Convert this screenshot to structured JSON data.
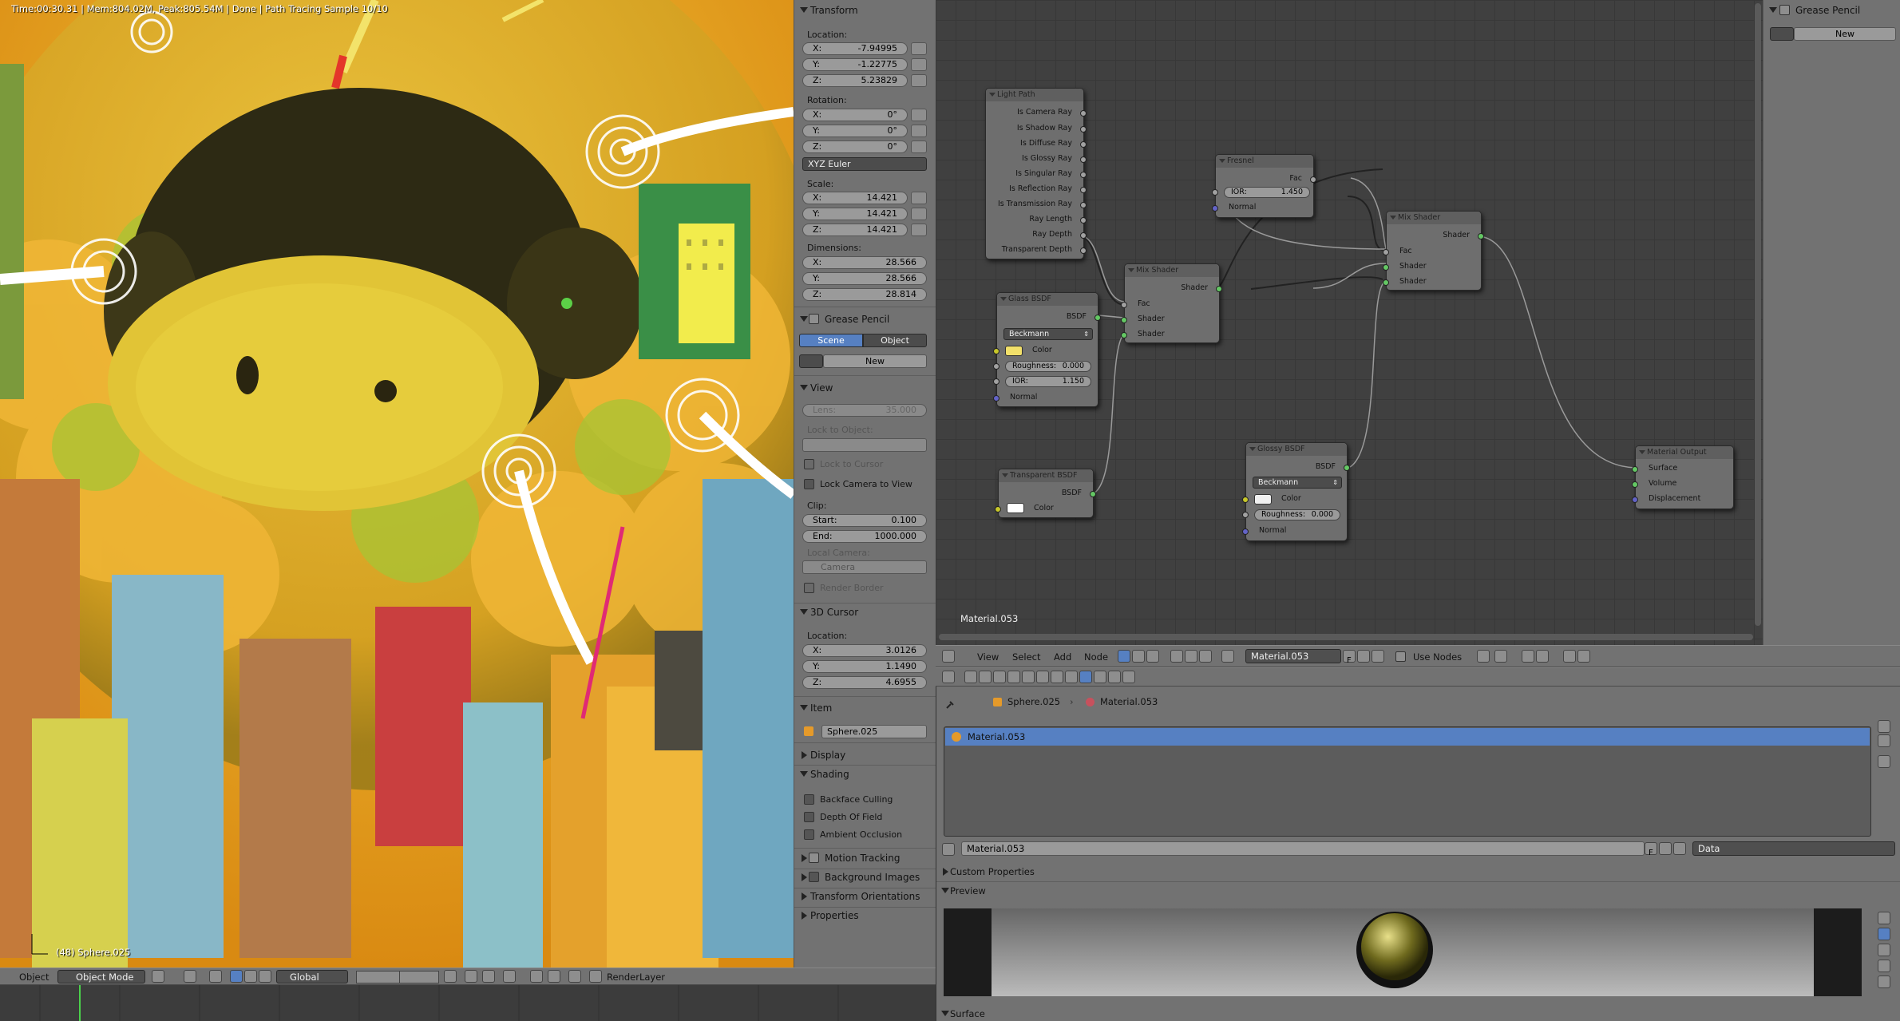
{
  "viewport": {
    "info": "Time:00:30.31 | Mem:804.02M, Peak:805.54M | Done | Path Tracing Sample 10/10",
    "object_label": "(48) Sphere.025"
  },
  "npanel": {
    "transform": {
      "header": "Transform",
      "location_label": "Location:",
      "location": [
        {
          "k": "X:",
          "v": "-7.94995"
        },
        {
          "k": "Y:",
          "v": "-1.22775"
        },
        {
          "k": "Z:",
          "v": "5.23829"
        }
      ],
      "rotation_label": "Rotation:",
      "rotation": [
        {
          "k": "X:",
          "v": "0°"
        },
        {
          "k": "Y:",
          "v": "0°"
        },
        {
          "k": "Z:",
          "v": "0°"
        }
      ],
      "rotation_mode": "XYZ Euler",
      "scale_label": "Scale:",
      "scale": [
        {
          "k": "X:",
          "v": "14.421"
        },
        {
          "k": "Y:",
          "v": "14.421"
        },
        {
          "k": "Z:",
          "v": "14.421"
        }
      ],
      "dimensions_label": "Dimensions:",
      "dimensions": [
        {
          "k": "X:",
          "v": "28.566"
        },
        {
          "k": "Y:",
          "v": "28.566"
        },
        {
          "k": "Z:",
          "v": "28.814"
        }
      ]
    },
    "grease_pencil": {
      "header": "Grease Pencil",
      "scene": "Scene",
      "object": "Object",
      "new": "New"
    },
    "view": {
      "header": "View",
      "lens_k": "Lens:",
      "lens_v": "35.000",
      "lock_to_object": "Lock to Object:",
      "lock_to_cursor": "Lock to Cursor",
      "lock_camera": "Lock Camera to View",
      "clip": "Clip:",
      "clip_start_k": "Start:",
      "clip_start_v": "0.100",
      "clip_end_k": "End:",
      "clip_end_v": "1000.000",
      "local_camera": "Local Camera:",
      "camera": "Camera",
      "render_border": "Render Border"
    },
    "cursor": {
      "header": "3D Cursor",
      "location_label": "Location:",
      "location": [
        {
          "k": "X:",
          "v": "3.0126"
        },
        {
          "k": "Y:",
          "v": "1.1490"
        },
        {
          "k": "Z:",
          "v": "4.6955"
        }
      ]
    },
    "item": {
      "header": "Item",
      "name": "Sphere.025"
    },
    "display": "Display",
    "shading": {
      "header": "Shading",
      "backface": "Backface Culling",
      "dof": "Depth Of Field",
      "ao": "Ambient Occlusion"
    },
    "motion_tracking": "Motion Tracking",
    "bg_images": "Background Images",
    "transform_orient": "Transform Orientations",
    "properties": "Properties"
  },
  "nodes": {
    "light_path": {
      "title": "Light Path",
      "outputs": [
        "Is Camera Ray",
        "Is Shadow Ray",
        "Is Diffuse Ray",
        "Is Glossy Ray",
        "Is Singular Ray",
        "Is Reflection Ray",
        "Is Transmission Ray",
        "Ray Length",
        "Ray Depth",
        "Transparent Depth"
      ]
    },
    "fresnel": {
      "title": "Fresnel",
      "ior_k": "IOR:",
      "ior_v": "1.450",
      "fac": "Fac",
      "normal": "Normal"
    },
    "mix1": {
      "title": "Mix Shader",
      "shader_out": "Shader",
      "fac": "Fac",
      "shader1": "Shader",
      "shader2": "Shader"
    },
    "mix2": {
      "title": "Mix Shader",
      "shader_out": "Shader",
      "fac": "Fac",
      "shader1": "Shader",
      "shader2": "Shader"
    },
    "glass": {
      "title": "Glass BSDF",
      "out": "BSDF",
      "dist": "Beckmann",
      "color": "Color",
      "rough_k": "Roughness:",
      "rough_v": "0.000",
      "ior_k": "IOR:",
      "ior_v": "1.150",
      "normal": "Normal",
      "swatch": "#f2e06a"
    },
    "transparent": {
      "title": "Transparent BSDF",
      "out": "BSDF",
      "color": "Color",
      "swatch": "#ffffff"
    },
    "glossy": {
      "title": "Glossy BSDF",
      "out": "BSDF",
      "dist": "Beckmann",
      "color": "Color",
      "rough_k": "Roughness:",
      "rough_v": "0.000",
      "normal": "Normal",
      "swatch": "#f0f0f0"
    },
    "output": {
      "title": "Material Output",
      "surface": "Surface",
      "volume": "Volume",
      "displacement": "Displacement"
    },
    "material_label": "Material.053"
  },
  "right_panel": {
    "header": "Grease Pencil",
    "new": "New"
  },
  "node_header": {
    "view": "View",
    "select": "Select",
    "add": "Add",
    "node": "Node",
    "material": "Material.053",
    "f": "F",
    "use_nodes": "Use Nodes"
  },
  "props": {
    "breadcrumb_obj": "Sphere.025",
    "breadcrumb_mat": "Material.053",
    "slot": "Material.053",
    "mat_field": "Material.053",
    "f": "F",
    "data": "Data",
    "custom_props": "Custom Properties",
    "preview": "Preview",
    "surface": "Surface"
  },
  "bottom_bar": {
    "object": "Object",
    "mode": "Object Mode",
    "orientation": "Global",
    "render_layer": "RenderLayer"
  },
  "colors": {
    "accent": "#5680c2",
    "socket_shader": "#64c864",
    "socket_color": "#c7c729",
    "socket_value": "#a1a1a1",
    "socket_vector": "#6363c7"
  }
}
